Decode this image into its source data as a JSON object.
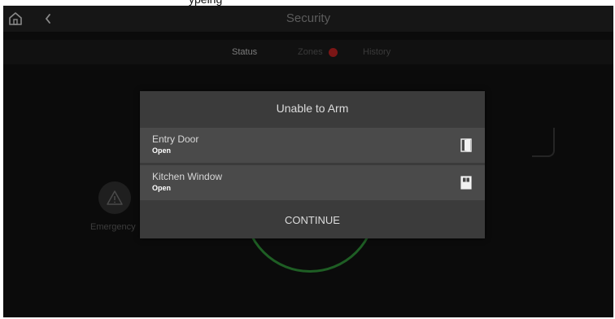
{
  "caption": {
    "partial_text": "ypeing"
  },
  "header": {
    "title": "Security",
    "home_icon": "home-icon",
    "back_icon": "chevron-left-icon"
  },
  "tabs": [
    {
      "label": "Status",
      "active": true
    },
    {
      "label": "Zones",
      "badge_color": "#7b1616"
    },
    {
      "label": "History"
    }
  ],
  "background": {
    "emergency_label": "Emergency",
    "emergency_icon": "warning-icon",
    "arm_ring_color": "#1e5e24"
  },
  "dialog": {
    "title": "Unable to Arm",
    "zones": [
      {
        "name": "Entry Door",
        "state": "Open",
        "icon": "door-open-icon"
      },
      {
        "name": "Kitchen Window",
        "state": "Open",
        "icon": "window-open-icon"
      }
    ],
    "continue_label": "CONTINUE"
  },
  "colors": {
    "screen_background": "#0b0b0b",
    "dialog_background": "#3b3b3b",
    "row_background": "#4a4a4a"
  }
}
